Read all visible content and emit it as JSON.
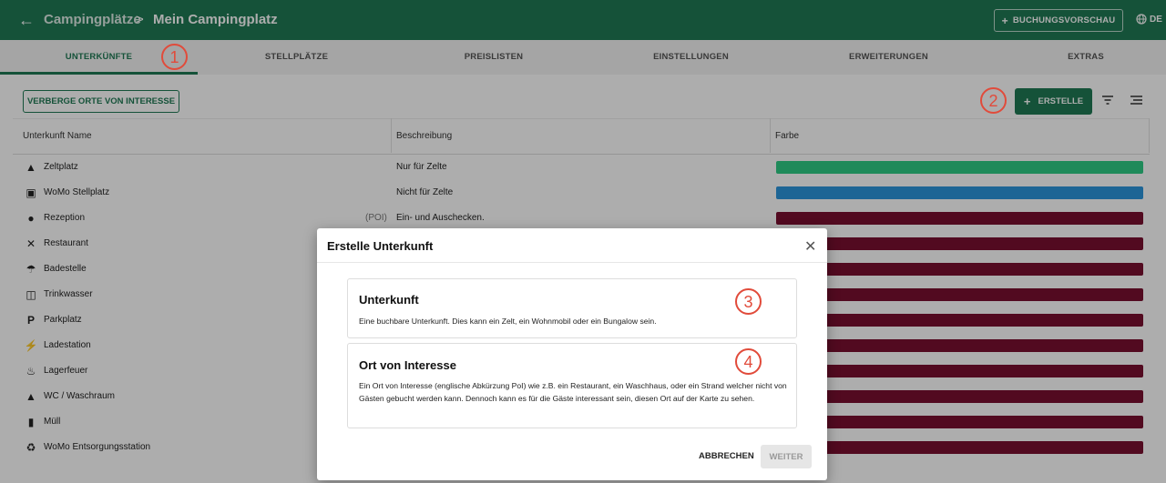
{
  "appbar": {
    "back_icon": "arrow-left-icon",
    "crumb_parent": "Campingplätze",
    "crumb_separator": ">",
    "crumb_current": "Mein Campingplatz",
    "preview_button": "BUCHUNGSVORSCHAU",
    "language": "DE",
    "background": "#1f7a55"
  },
  "tabs": [
    "UNTERKÜNFTE",
    "STELLPLÄTZE",
    "PREISLISTEN",
    "EINSTELLUNGEN",
    "ERWEITERUNGEN",
    "EXTRAS"
  ],
  "active_tab": "UNTERKÜNFTE",
  "toolbar": {
    "hide_poi_button": "VERBERGE ORTE VON INTERESSE",
    "create_button": "ERSTELLE"
  },
  "table": {
    "headers": [
      "Unterkunft Name",
      "Beschreibung",
      "Farbe"
    ],
    "rows": [
      {
        "icon": "tent-icon",
        "name": "Zeltplatz",
        "poi": "",
        "desc": "Nur für Zelte",
        "color": "#2ecc85"
      },
      {
        "icon": "bus-icon",
        "name": "WoMo Stellplatz",
        "poi": "",
        "desc": "Nicht für Zelte",
        "color": "#2b95dc"
      },
      {
        "icon": "info-icon",
        "name": "Rezeption",
        "poi": "(POI)",
        "desc": "Ein- und Auschecken.",
        "color": "#7a1030"
      },
      {
        "icon": "restaurant-icon",
        "name": "Restaurant",
        "poi": "",
        "desc": "",
        "color": "#7a1030"
      },
      {
        "icon": "beach-icon",
        "name": "Badestelle",
        "poi": "",
        "desc": "",
        "color": "#7a1030"
      },
      {
        "icon": "water-icon",
        "name": "Trinkwasser",
        "poi": "",
        "desc": "",
        "color": "#7a1030"
      },
      {
        "icon": "parking-icon",
        "name": "Parkplatz",
        "poi": "",
        "desc": "",
        "color": "#7a1030"
      },
      {
        "icon": "charging-icon",
        "name": "Ladestation",
        "poi": "",
        "desc": "",
        "color": "#7a1030"
      },
      {
        "icon": "fire-icon",
        "name": "Lagerfeuer",
        "poi": "",
        "desc": "",
        "color": "#7a1030"
      },
      {
        "icon": "shower-icon",
        "name": "WC / Waschraum",
        "poi": "",
        "desc": "",
        "color": "#7a1030"
      },
      {
        "icon": "trash-icon",
        "name": "Müll",
        "poi": "",
        "desc": "",
        "color": "#7a1030"
      },
      {
        "icon": "recycle-icon",
        "name": "WoMo Entsorgungsstation",
        "poi": "",
        "desc": "",
        "color": "#7a1030"
      }
    ]
  },
  "annotations": [
    "1",
    "2",
    "3",
    "4"
  ],
  "dialog": {
    "title": "Erstelle Unterkunft",
    "option1_title": "Unterkunft",
    "option1_text": "Eine buchbare Unterkunft. Dies kann ein Zelt, ein Wohnmobil oder ein Bungalow sein.",
    "option2_title": "Ort von Interesse",
    "option2_text": "Ein Ort von Interesse (englische Abkürzung PoI) wie z.B. ein Restaurant, ein Waschhaus, oder ein Strand welcher nicht von Gästen gebucht werden kann. Dennoch kann es für die Gäste interessant sein, diesen Ort auf der Karte zu sehen.",
    "cancel": "ABBRECHEN",
    "next": "WEITER"
  }
}
